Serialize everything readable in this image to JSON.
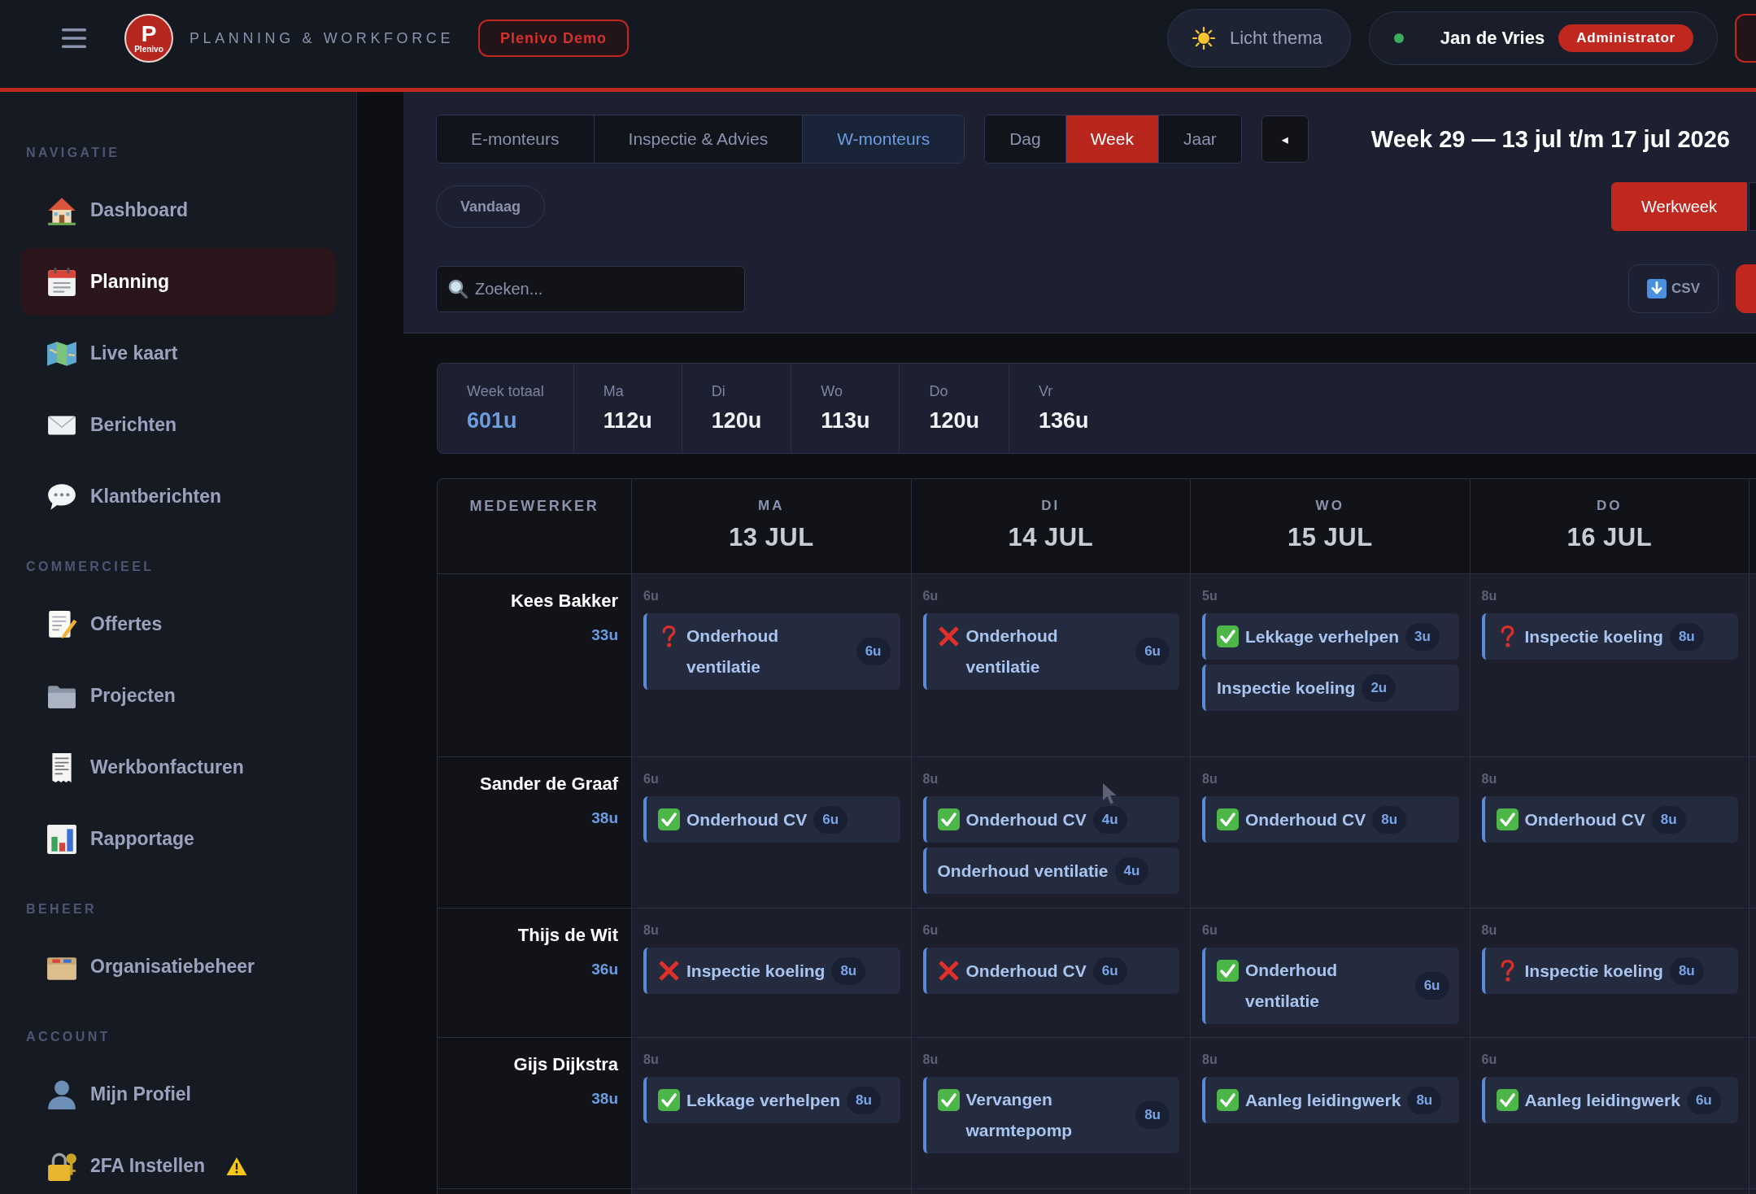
{
  "topbar": {
    "logo": {
      "mark": "P",
      "wordmark": "Plenivo"
    },
    "app_title": "PLANNING & WORKFORCE",
    "demo_badge": "Plenivo Demo",
    "theme_button": "Licht thema",
    "user": {
      "online": true,
      "name": "Jan de Vries",
      "role": "Administrator"
    }
  },
  "sidebar": {
    "sections": [
      {
        "title": "NAVIGATIE",
        "items": [
          {
            "kind": "dashboard",
            "label": "Dashboard",
            "selected": false,
            "warning": false
          },
          {
            "kind": "planning",
            "label": "Planning",
            "selected": true,
            "warning": false
          },
          {
            "kind": "map",
            "label": "Live kaart",
            "selected": false,
            "warning": false
          },
          {
            "kind": "messages",
            "label": "Berichten",
            "selected": false,
            "warning": false
          },
          {
            "kind": "chat",
            "label": "Klantberichten",
            "selected": false,
            "warning": false
          }
        ]
      },
      {
        "title": "COMMERCIEEL",
        "items": [
          {
            "kind": "quotes",
            "label": "Offertes",
            "selected": false,
            "warning": false
          },
          {
            "kind": "projects",
            "label": "Projecten",
            "selected": false,
            "warning": false
          },
          {
            "kind": "invoices",
            "label": "Werkbonfacturen",
            "selected": false,
            "warning": false
          },
          {
            "kind": "reports",
            "label": "Rapportage",
            "selected": false,
            "warning": false
          }
        ]
      },
      {
        "title": "BEHEER",
        "items": [
          {
            "kind": "organisation",
            "label": "Organisatiebeheer",
            "selected": false,
            "warning": false
          }
        ]
      },
      {
        "title": "ACCOUNT",
        "items": [
          {
            "kind": "profile",
            "label": "Mijn Profiel",
            "selected": false,
            "warning": false
          },
          {
            "kind": "security",
            "label": "2FA Instellen",
            "selected": false,
            "warning": true
          }
        ]
      }
    ]
  },
  "toolbar": {
    "team_tabs": [
      {
        "label": "E-monteurs",
        "selected": false
      },
      {
        "label": "Inspectie & Advies",
        "selected": false
      },
      {
        "label": "W-monteurs",
        "selected": true
      }
    ],
    "view_tabs": [
      {
        "label": "Dag",
        "selected": false
      },
      {
        "label": "Week",
        "selected": true
      },
      {
        "label": "Jaar",
        "selected": false
      }
    ],
    "prev_button": "◂",
    "period_title": "Week 29 — 13 jul t/m 17 jul 2026",
    "today_button": "Vandaag",
    "range_tabs": [
      {
        "label": "Werkweek",
        "selected": true
      }
    ],
    "search": {
      "placeholder": "Zoeken..."
    },
    "export_button": "CSV"
  },
  "summary": [
    {
      "kind": "total",
      "label": "Week totaal",
      "value": "601u"
    },
    {
      "kind": "day",
      "label": "Ma",
      "value": "112u"
    },
    {
      "kind": "day",
      "label": "Di",
      "value": "120u"
    },
    {
      "kind": "day",
      "label": "Wo",
      "value": "113u"
    },
    {
      "kind": "day",
      "label": "Do",
      "value": "120u"
    },
    {
      "kind": "day",
      "label": "Vr",
      "value": "136u"
    }
  ],
  "schedule": {
    "employee_header": "MEDEWERKER",
    "days": [
      {
        "weekday": "MA",
        "date": "13 JUL"
      },
      {
        "weekday": "DI",
        "date": "14 JUL"
      },
      {
        "weekday": "WO",
        "date": "15 JUL"
      },
      {
        "weekday": "DO",
        "date": "16 JUL"
      }
    ],
    "rows": [
      {
        "name": "Kees Bakker",
        "hours": "33u",
        "days": [
          {
            "hours": "6u",
            "tasks": [
              {
                "kind": "pending",
                "title": "Onderhoud ventilatie",
                "hours": "6u"
              }
            ]
          },
          {
            "hours": "6u",
            "tasks": [
              {
                "kind": "cancelled",
                "title": "Onderhoud ventilatie",
                "hours": "6u"
              }
            ]
          },
          {
            "hours": "5u",
            "tasks": [
              {
                "kind": "done",
                "title": "Lekkage verhelpen",
                "hours": "3u"
              },
              {
                "kind": "plain",
                "title": "Inspectie koeling",
                "hours": "2u"
              }
            ]
          },
          {
            "hours": "8u",
            "tasks": [
              {
                "kind": "pending",
                "title": "Inspectie koeling",
                "hours": "8u"
              }
            ]
          }
        ]
      },
      {
        "name": "Sander de Graaf",
        "hours": "38u",
        "days": [
          {
            "hours": "6u",
            "tasks": [
              {
                "kind": "done",
                "title": "Onderhoud CV",
                "hours": "6u"
              }
            ]
          },
          {
            "hours": "8u",
            "tasks": [
              {
                "kind": "done",
                "title": "Onderhoud CV",
                "hours": "4u"
              },
              {
                "kind": "plain",
                "title": "Onderhoud ventilatie",
                "hours": "4u"
              }
            ]
          },
          {
            "hours": "8u",
            "tasks": [
              {
                "kind": "done",
                "title": "Onderhoud CV",
                "hours": "8u"
              }
            ]
          },
          {
            "hours": "8u",
            "tasks": [
              {
                "kind": "done",
                "title": "Onderhoud CV",
                "hours": "8u"
              }
            ]
          }
        ]
      },
      {
        "name": "Thijs de Wit",
        "hours": "36u",
        "days": [
          {
            "hours": "8u",
            "tasks": [
              {
                "kind": "cancelled",
                "title": "Inspectie koeling",
                "hours": "8u"
              }
            ]
          },
          {
            "hours": "6u",
            "tasks": [
              {
                "kind": "cancelled",
                "title": "Onderhoud CV",
                "hours": "6u"
              }
            ]
          },
          {
            "hours": "6u",
            "tasks": [
              {
                "kind": "done",
                "title": "Onderhoud ventilatie",
                "hours": "6u"
              }
            ]
          },
          {
            "hours": "8u",
            "tasks": [
              {
                "kind": "pending",
                "title": "Inspectie koeling",
                "hours": "8u"
              }
            ]
          }
        ]
      },
      {
        "name": "Gijs Dijkstra",
        "hours": "38u",
        "days": [
          {
            "hours": "8u",
            "tasks": [
              {
                "kind": "done",
                "title": "Lekkage verhelpen",
                "hours": "8u"
              }
            ]
          },
          {
            "hours": "8u",
            "tasks": [
              {
                "kind": "done",
                "title": "Vervangen warmtepomp",
                "hours": "8u"
              }
            ]
          },
          {
            "hours": "8u",
            "tasks": [
              {
                "kind": "done",
                "title": "Aanleg leidingwerk",
                "hours": "8u"
              }
            ]
          },
          {
            "hours": "6u",
            "tasks": [
              {
                "kind": "done",
                "title": "Aanleg leidingwerk",
                "hours": "6u"
              }
            ]
          }
        ]
      }
    ]
  }
}
